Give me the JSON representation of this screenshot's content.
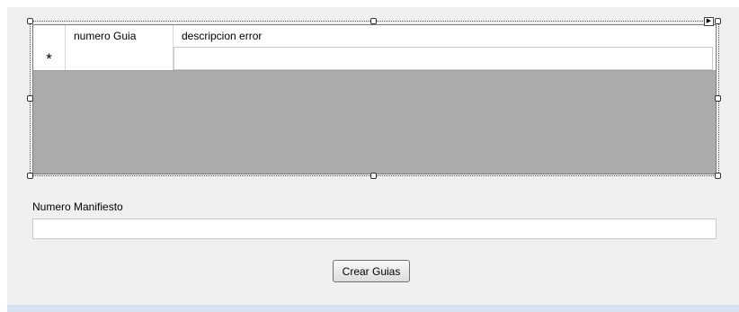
{
  "grid": {
    "columns": [
      "numero Guia",
      "descripcion error"
    ],
    "new_row_marker": "*"
  },
  "manifest": {
    "label": "Numero Manifiesto",
    "value": ""
  },
  "actions": {
    "create_label": "Crear Guias"
  },
  "colors": {
    "form_background": "#f0f0f0",
    "grid_background": "#ababab",
    "bottom_strip": "#d5e3f1"
  }
}
